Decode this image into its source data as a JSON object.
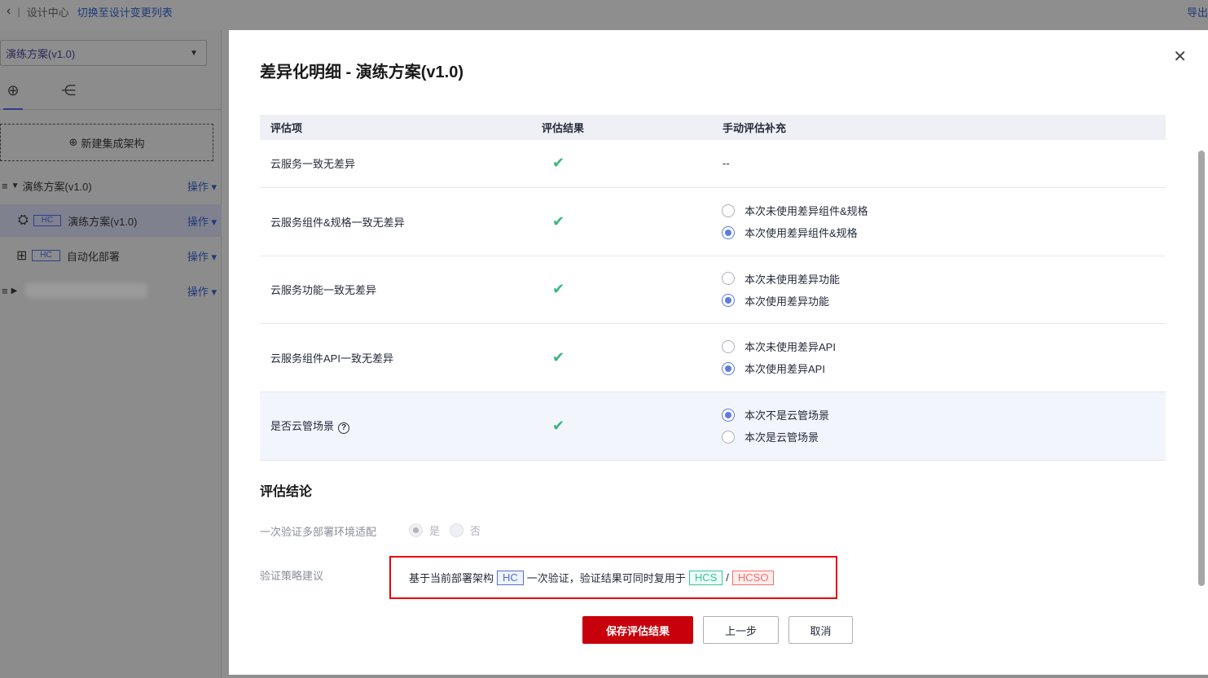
{
  "topbar": {
    "back_icon": "‹",
    "title": "设计中心",
    "switch_link": "切换至设计变更列表",
    "right_link": "导出"
  },
  "sidebar": {
    "select_value": "演练方案(v1.0)",
    "new_button": "新建集成架构",
    "items": [
      {
        "label": "演练方案(v1.0)",
        "op": "操作"
      },
      {
        "tag": "HC",
        "label": "演练方案(v1.0)",
        "op": "操作"
      },
      {
        "tag": "HC",
        "label": "自动化部署",
        "op": "操作"
      },
      {
        "label": "",
        "op": "操作"
      }
    ]
  },
  "dialog": {
    "title": "差异化明细 - 演练方案(v1.0)",
    "table": {
      "headers": [
        "评估项",
        "评估结果",
        "手动评估补充"
      ],
      "rows": [
        {
          "item": "云服务一致无差异",
          "result": "✔",
          "supplement": "--"
        },
        {
          "item": "云服务组件&规格一致无差异",
          "result": "✔",
          "opt1": "本次未使用差异组件&规格",
          "opt2": "本次使用差异组件&规格"
        },
        {
          "item": "云服务功能一致无差异",
          "result": "✔",
          "opt1": "本次未使用差异功能",
          "opt2": "本次使用差异功能"
        },
        {
          "item": "云服务组件API一致无差异",
          "result": "✔",
          "opt1": "本次未使用差异API",
          "opt2": "本次使用差异API"
        },
        {
          "item": "是否云管场景",
          "result": "✔",
          "opt1": "本次不是云管场景",
          "opt2": "本次是云管场景"
        }
      ]
    },
    "conclusion": {
      "title": "评估结论",
      "verify_label": "一次验证多部署环境适配",
      "yes": "是",
      "no": "否",
      "strategy_label": "验证策略建议",
      "strategy_prefix": "基于当前部署架构",
      "tag_hc": "HC",
      "strategy_middle": "一次验证，验证结果可同时复用于",
      "tag_hcs": "HCS",
      "slash": "/",
      "tag_hcso": "HCSO"
    },
    "buttons": {
      "save": "保存评估结果",
      "prev": "上一步",
      "cancel": "取消"
    }
  }
}
